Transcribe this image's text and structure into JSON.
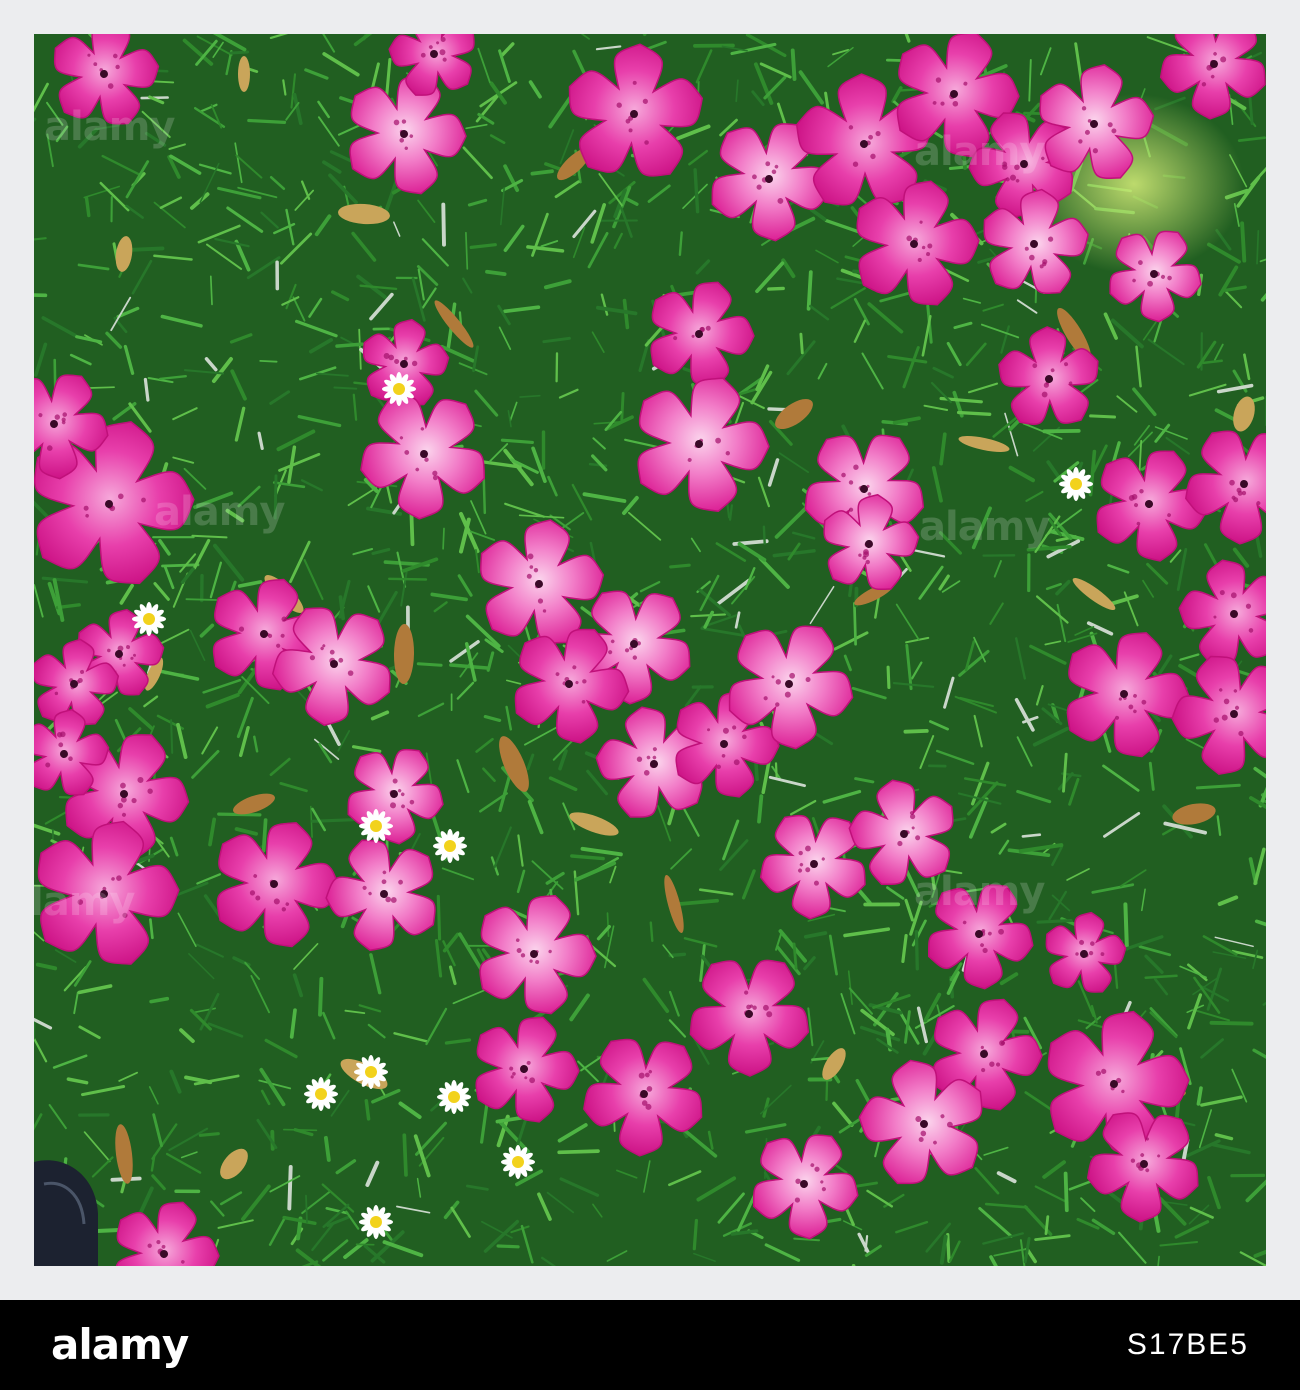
{
  "photo": {
    "subject": "fallen-pink-rhododendron-flowers-on-grass",
    "colors": {
      "grass_dark": "#1f5a1f",
      "grass_mid": "#2f8a2c",
      "grass_light": "#5fbf4a",
      "flower_magenta": "#e22a9e",
      "flower_pink": "#f06ac0",
      "flower_light": "#f8c6e6",
      "daisy_white": "#ffffff",
      "daisy_center": "#f2d21c",
      "frame": "#ecedef"
    }
  },
  "watermark": {
    "text": "alamy"
  },
  "stock_bar": {
    "logo": "alamy",
    "image_id": "S17BE5",
    "background": "#000000"
  }
}
